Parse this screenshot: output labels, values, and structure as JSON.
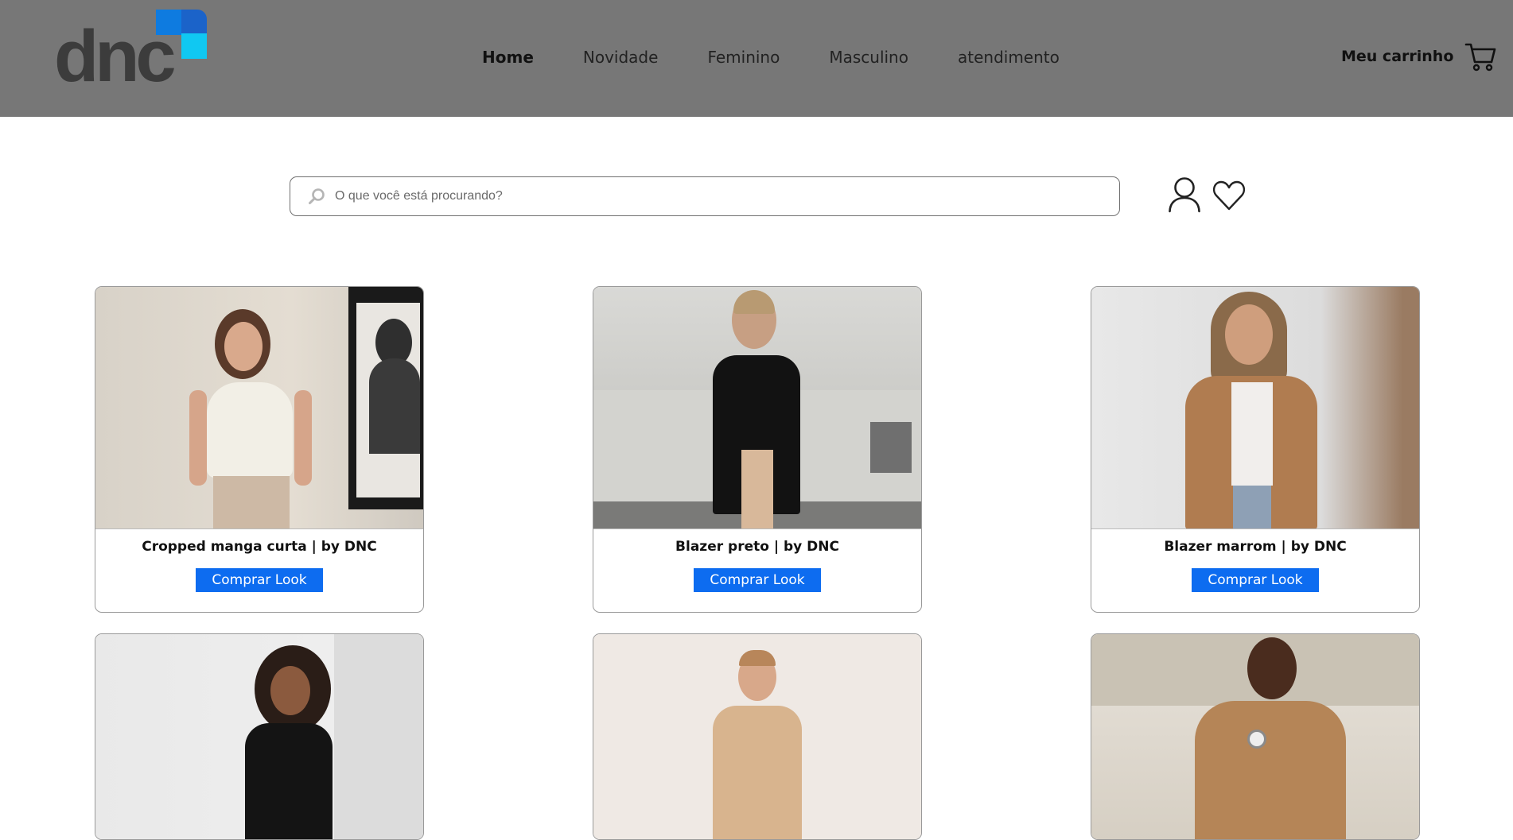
{
  "brand": {
    "logo_text": "dnc"
  },
  "nav": {
    "items": [
      {
        "label": "Home",
        "active": true
      },
      {
        "label": "Novidade",
        "active": false
      },
      {
        "label": "Feminino",
        "active": false
      },
      {
        "label": "Masculino",
        "active": false
      },
      {
        "label": "atendimento",
        "active": false
      }
    ]
  },
  "cart": {
    "label": "Meu carrinho",
    "icon": "cart-icon"
  },
  "search": {
    "placeholder": "O que você está procurando?",
    "value": "",
    "icon": "search-icon"
  },
  "account_icons": [
    "user-icon",
    "heart-icon"
  ],
  "products": [
    {
      "title": "Cropped manga curta | by DNC",
      "button": "Comprar Look"
    },
    {
      "title": "Blazer preto | by DNC",
      "button": "Comprar Look"
    },
    {
      "title": "Blazer marrom | by DNC",
      "button": "Comprar Look"
    },
    {
      "title": "",
      "button": ""
    },
    {
      "title": "",
      "button": ""
    },
    {
      "title": "",
      "button": ""
    }
  ],
  "colors": {
    "header_bg": "#777777",
    "button_bg": "#0d6cf0",
    "logo_dark": "#3c3c3c",
    "logo_blue": "#0e7be0",
    "logo_cyan": "#10c8f2"
  }
}
